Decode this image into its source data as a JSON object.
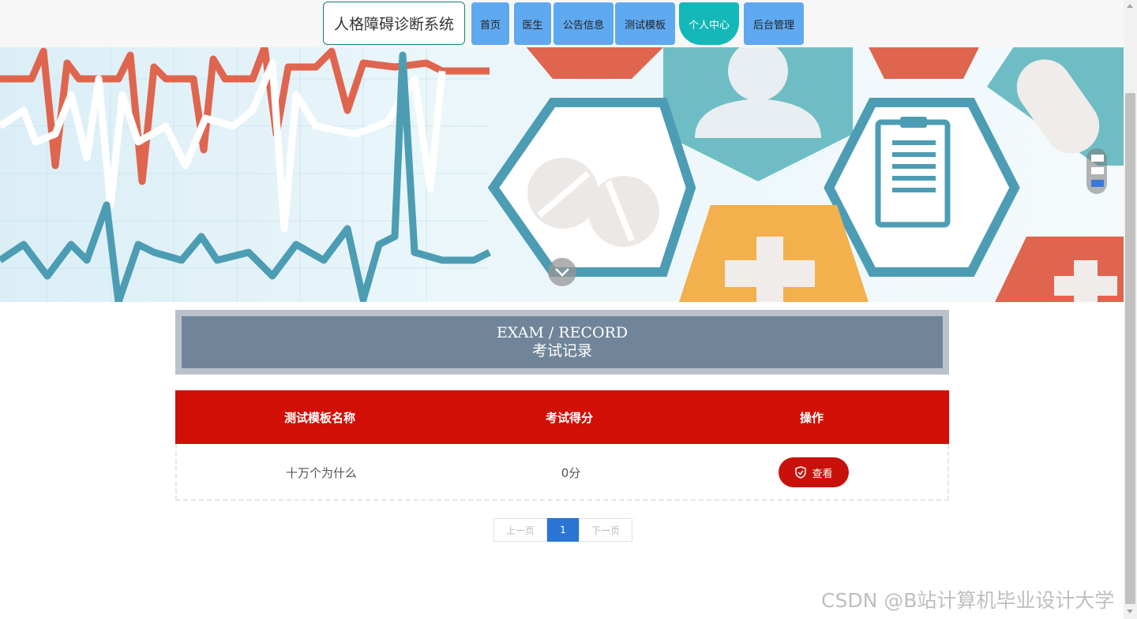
{
  "header": {
    "logo": "人格障碍诊断系统",
    "nav": [
      {
        "label": "首页"
      },
      {
        "label": "医生"
      },
      {
        "label": "公告信息"
      },
      {
        "label": "测试模板"
      },
      {
        "label": "个人中心",
        "active": true
      },
      {
        "label": "后台管理"
      }
    ]
  },
  "banner": {
    "icons": [
      "heartbeat-line",
      "doctor-icon",
      "pill-icon",
      "clipboard-icon",
      "medical-cross-icon",
      "capsule-icon"
    ],
    "carousel_dots": 3,
    "active_dot": 3
  },
  "section": {
    "title_en": "EXAM / RECORD",
    "title_cn": "考试记录"
  },
  "table": {
    "headers": [
      "测试模板名称",
      "考试得分",
      "操作"
    ],
    "rows": [
      {
        "name": "十万个为什么",
        "score": "0分",
        "action": "查看"
      }
    ]
  },
  "pagination": {
    "prev": "上一页",
    "current": "1",
    "next": "下一页"
  },
  "watermark": "CSDN @B站计算机毕业设计大学",
  "colors": {
    "nav": "#5fa9f0",
    "nav_active": "#15b8b8",
    "table_head": "#d10f06",
    "title_bg": "#708599",
    "page_active": "#2a74d4"
  }
}
